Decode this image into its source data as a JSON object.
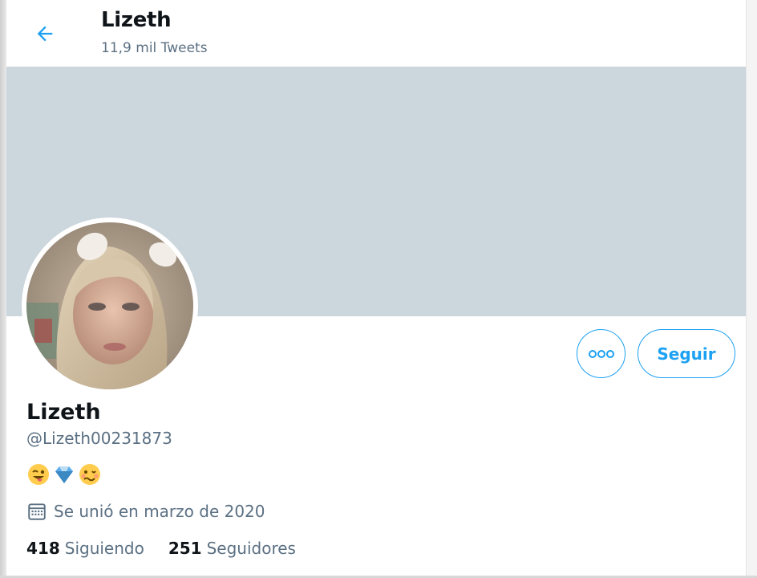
{
  "header": {
    "title": "Lizeth",
    "tweet_count": "11,9 mil Tweets"
  },
  "colors": {
    "accent": "#1da1f2",
    "banner": "#ccd6dd",
    "secondary_text": "#5b7083"
  },
  "profile": {
    "name": "Lizeth",
    "handle": "@Lizeth00231873",
    "bio_emojis": [
      "winking-face-with-tongue",
      "gem-stone",
      "woozy-face"
    ],
    "joined": "Se unió en marzo de 2020",
    "following_count": "418",
    "following_label": "Siguiendo",
    "followers_count": "251",
    "followers_label": "Seguidores"
  },
  "actions": {
    "follow_label": "Seguir",
    "more_icon": "more-options-icon"
  }
}
